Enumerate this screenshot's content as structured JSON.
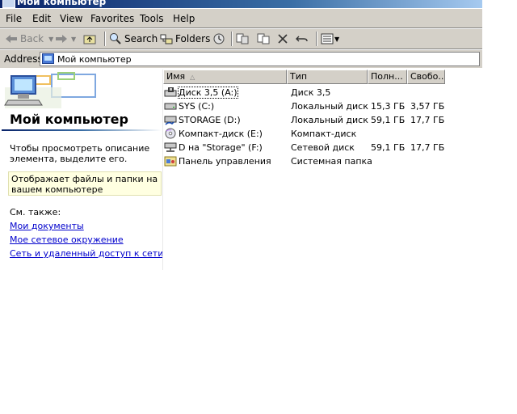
{
  "window": {
    "title": "Мой компьютер"
  },
  "menu": [
    {
      "label": "File"
    },
    {
      "label": "Edit"
    },
    {
      "label": "View"
    },
    {
      "label": "Favorites"
    },
    {
      "label": "Tools"
    },
    {
      "label": "Help"
    }
  ],
  "toolbar": {
    "back_label": "Back",
    "search_label": "Search",
    "folders_label": "Folders"
  },
  "address": {
    "label": "Address",
    "value": "Мой компьютер"
  },
  "left_panel": {
    "title": "Мой компьютер",
    "hint": "Чтобы просмотреть описание элемента, выделите его.",
    "info": "Отображает файлы и папки на вашем компьютере",
    "see_also": "См. также:",
    "links": [
      {
        "label": "Мои документы"
      },
      {
        "label": "Мое сетевое окружение"
      },
      {
        "label": "Сеть и удаленный доступ к сети"
      }
    ]
  },
  "list": {
    "columns": [
      {
        "label": "Имя"
      },
      {
        "label": "Тип"
      },
      {
        "label": "Полн..."
      },
      {
        "label": "Свобо..."
      }
    ],
    "rows": [
      {
        "name": "Диск 3,5 (A:)",
        "type": "Диск 3,5",
        "total": "",
        "free": "",
        "icon": "floppy-drive-icon"
      },
      {
        "name": "SYS (C:)",
        "type": "Локальный диск",
        "total": "15,3 ГБ",
        "free": "3,57 ГБ",
        "icon": "hard-disk-icon"
      },
      {
        "name": "STORAGE (D:)",
        "type": "Локальный диск",
        "total": "59,1 ГБ",
        "free": "17,7 ГБ",
        "icon": "shared-hard-disk-icon"
      },
      {
        "name": "Компакт-диск (E:)",
        "type": "Компакт-диск",
        "total": "",
        "free": "",
        "icon": "cd-drive-icon"
      },
      {
        "name": "D на \"Storage\" (F:)",
        "type": "Сетевой диск",
        "total": "59,1 ГБ",
        "free": "17,7 ГБ",
        "icon": "network-drive-icon"
      },
      {
        "name": "Панель управления",
        "type": "Системная папка",
        "total": "",
        "free": "",
        "icon": "control-panel-icon"
      }
    ]
  },
  "colors": {
    "title_bar": "#0a246a",
    "chrome": "#d4d0c8",
    "link": "#0000cc",
    "info_bg": "#ffffe1"
  }
}
